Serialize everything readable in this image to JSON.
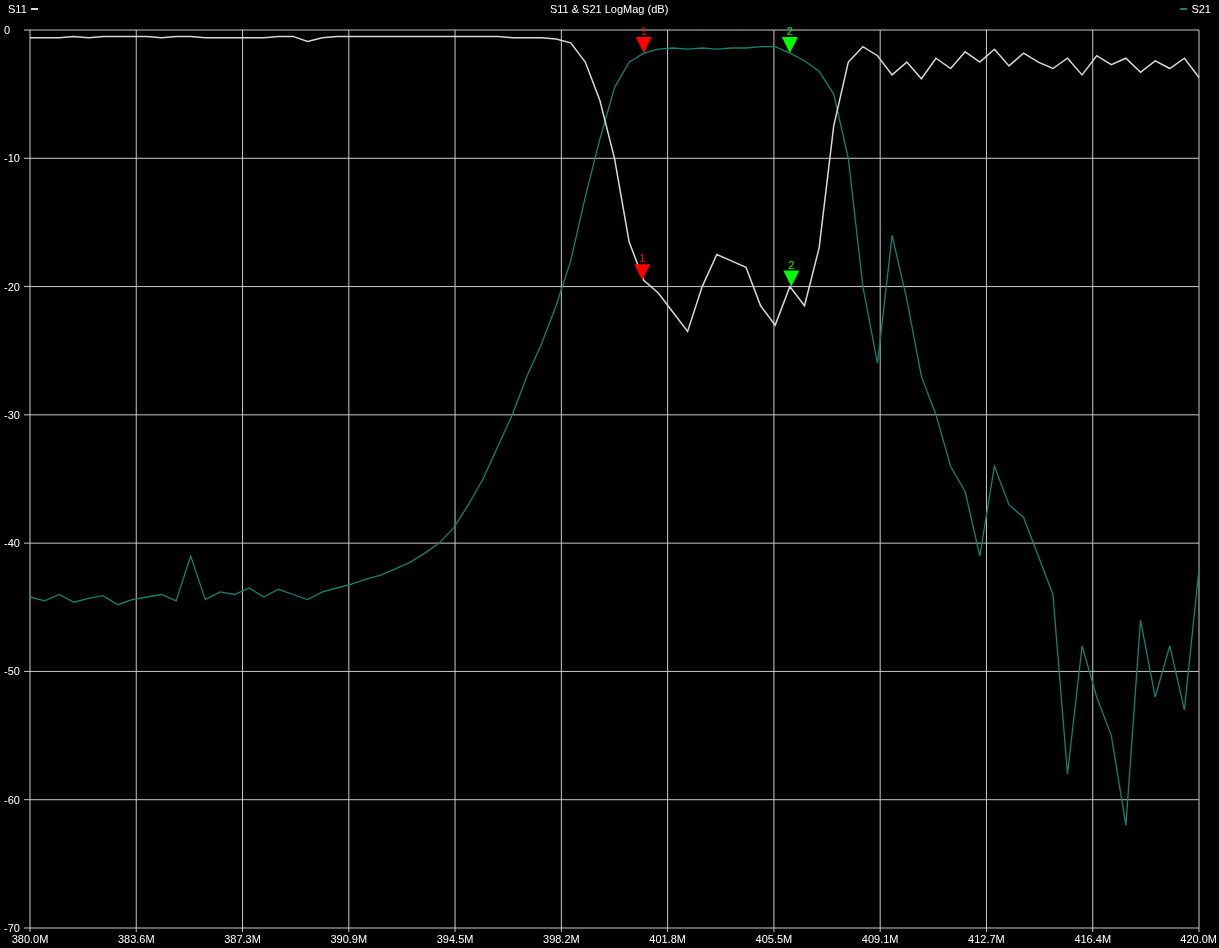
{
  "chart_data": {
    "type": "line",
    "title": "S11 & S21 LogMag (dB)",
    "x": [
      380,
      380.5,
      381,
      381.5,
      382,
      382.5,
      383,
      383.5,
      384,
      384.5,
      385,
      385.5,
      386,
      386.5,
      387,
      387.5,
      388,
      388.5,
      389,
      389.5,
      390,
      390.5,
      391,
      391.5,
      392,
      392.5,
      393,
      393.5,
      394,
      394.5,
      395,
      395.5,
      396,
      396.5,
      397,
      397.5,
      398,
      398.5,
      399,
      399.5,
      400,
      400.5,
      401,
      401.5,
      402,
      402.5,
      403,
      403.5,
      404,
      404.5,
      405,
      405.5,
      406,
      406.5,
      407,
      407.5,
      408,
      408.5,
      409,
      409.5,
      410,
      410.5,
      411,
      411.5,
      412,
      412.5,
      413,
      413.5,
      414,
      414.5,
      415,
      415.5,
      416,
      416.5,
      417,
      417.5,
      418,
      418.5,
      419,
      419.5,
      420
    ],
    "series": [
      {
        "name": "S11",
        "color": "#d8d8d8",
        "values": [
          -0.6,
          -0.6,
          -0.6,
          -0.5,
          -0.6,
          -0.5,
          -0.5,
          -0.5,
          -0.5,
          -0.6,
          -0.5,
          -0.5,
          -0.6,
          -0.6,
          -0.6,
          -0.6,
          -0.6,
          -0.5,
          -0.5,
          -0.9,
          -0.6,
          -0.5,
          -0.5,
          -0.5,
          -0.5,
          -0.5,
          -0.5,
          -0.5,
          -0.5,
          -0.5,
          -0.5,
          -0.5,
          -0.5,
          -0.6,
          -0.6,
          -0.6,
          -0.7,
          -1.0,
          -2.5,
          -5.5,
          -10,
          -16.5,
          -19.5,
          -20.5,
          -22,
          -23.5,
          -20,
          -17.5,
          -18,
          -18.5,
          -21.5,
          -23,
          -20,
          -21.5,
          -17,
          -7.5,
          -2.5,
          -1.3,
          -2,
          -3.5,
          -2.5,
          -3.8,
          -2.2,
          -3,
          -1.7,
          -2.5,
          -1.5,
          -2.8,
          -1.8,
          -2.5,
          -3,
          -2.2,
          -3.5,
          -2,
          -2.7,
          -2.2,
          -3.3,
          -2.4,
          -3,
          -2.2,
          -3.7
        ]
      },
      {
        "name": "S21",
        "color": "#138272",
        "values": [
          -44.2,
          -44.5,
          -44,
          -44.6,
          -44.3,
          -44.1,
          -44.8,
          -44.4,
          -44.2,
          -44,
          -44.5,
          -41,
          -44.4,
          -43.8,
          -44,
          -43.5,
          -44.2,
          -43.6,
          -44,
          -44.4,
          -43.8,
          -43.5,
          -43.2,
          -42.8,
          -42.5,
          -42,
          -41.5,
          -40.8,
          -40,
          -38.8,
          -37,
          -35,
          -32.5,
          -30,
          -27,
          -24.5,
          -21.5,
          -18,
          -13,
          -8.5,
          -4.5,
          -2.5,
          -1.8,
          -1.5,
          -1.4,
          -1.5,
          -1.4,
          -1.5,
          -1.4,
          -1.4,
          -1.3,
          -1.3,
          -1.8,
          -2.4,
          -3.2,
          -5,
          -10,
          -20,
          -26,
          -16,
          -21,
          -27,
          -30,
          -34,
          -36,
          -41,
          -34,
          -37,
          -38,
          -41,
          -44,
          -58,
          -48,
          -52,
          -55,
          -62,
          -46,
          -52,
          -48,
          -53,
          -42
        ]
      }
    ],
    "xlim": [
      380,
      420
    ],
    "ylim": [
      -70,
      0
    ],
    "xticks": [
      {
        "value": 380,
        "label": "380.0M"
      },
      {
        "value": 383.636,
        "label": "383.6M"
      },
      {
        "value": 387.273,
        "label": "387.3M"
      },
      {
        "value": 390.909,
        "label": "390.9M"
      },
      {
        "value": 394.545,
        "label": "394.5M"
      },
      {
        "value": 398.182,
        "label": "398.2M"
      },
      {
        "value": 401.818,
        "label": "401.8M"
      },
      {
        "value": 405.455,
        "label": "405.5M"
      },
      {
        "value": 409.091,
        "label": "409.1M"
      },
      {
        "value": 412.727,
        "label": "412.7M"
      },
      {
        "value": 416.364,
        "label": "416.4M"
      },
      {
        "value": 420,
        "label": "420.0M"
      }
    ],
    "yticks": [
      0,
      -10,
      -20,
      -30,
      -40,
      -50,
      -60,
      -70
    ],
    "grid": true,
    "annotations": [
      {
        "text": "1",
        "x": 401.0,
        "y": -1.8
      },
      {
        "text": "2",
        "x": 406.0,
        "y": -1.8
      },
      {
        "text": "1",
        "x": 400.95,
        "y": -19.5
      },
      {
        "text": "2",
        "x": 406.05,
        "y": -20
      }
    ]
  },
  "markers": [
    {
      "color": "#ff0000"
    },
    {
      "color": "#00ff00"
    }
  ]
}
